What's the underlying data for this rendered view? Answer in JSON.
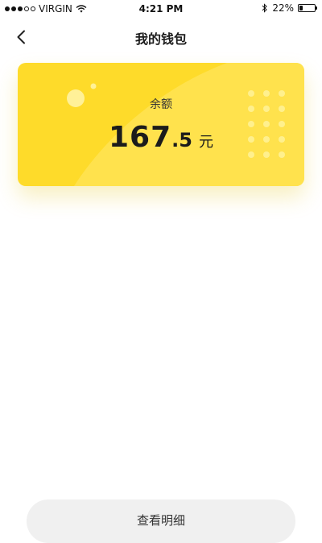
{
  "status_bar": {
    "carrier": "VIRGIN",
    "time": "4:21 PM",
    "battery_percent": "22%",
    "battery_level": 0.22,
    "signal_dots_filled": 3,
    "signal_dots_total": 5,
    "icons": [
      "wifi-icon",
      "bluetooth-icon",
      "battery-icon"
    ]
  },
  "nav": {
    "title": "我的钱包",
    "back_icon": "chevron-left-icon"
  },
  "balance_card": {
    "label": "余额",
    "amount_integer": "167",
    "amount_decimal": ".5",
    "unit": "元",
    "color": "#fedb2a"
  },
  "bottom_button": {
    "label": "查看明细"
  }
}
